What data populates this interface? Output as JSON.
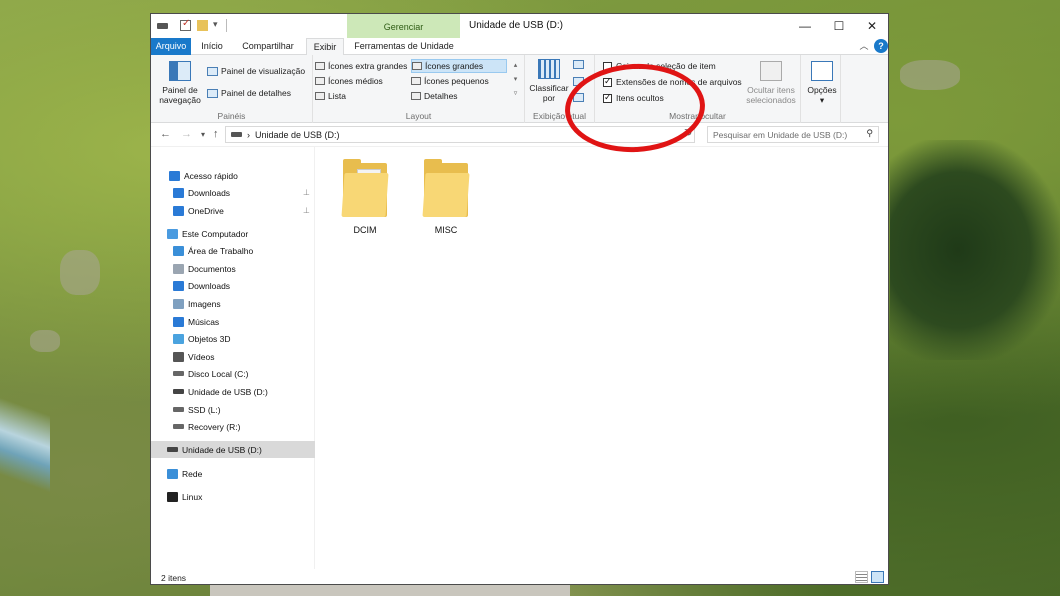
{
  "window": {
    "title": "Unidade de USB (D:)",
    "contextual_header": "Gerenciar",
    "controls": {
      "minimize": "—",
      "maximize": "☐",
      "close": "✕"
    }
  },
  "tabs": {
    "arquivo": "Arquivo",
    "inicio": "Início",
    "compartilhar": "Compartilhar",
    "exibir": "Exibir",
    "ferramentas": "Ferramentas de Unidade",
    "active": "Exibir"
  },
  "ribbon": {
    "paineis": {
      "label": "Painéis",
      "nav_pane_line1": "Painel de",
      "nav_pane_line2": "navegação",
      "preview": "Painel de visualização",
      "details": "Painel de detalhes"
    },
    "layout": {
      "label": "Layout",
      "items": [
        "Ícones extra grandes",
        "Ícones grandes",
        "Ícones médios",
        "Ícones pequenos",
        "Lista",
        "Detalhes"
      ],
      "selected": "Ícones grandes"
    },
    "exibicao_atual": {
      "label": "Exibição atual",
      "sort_line1": "Classificar",
      "sort_line2": "por"
    },
    "mostrar_ocultar": {
      "label": "Mostrar/ocultar",
      "item_checkboxes": {
        "label": "Caixas de seleção de item",
        "checked": false
      },
      "file_extensions": {
        "label": "Extensões de nomes de arquivos",
        "checked": true
      },
      "hidden_items": {
        "label": "Itens ocultos",
        "checked": true
      },
      "hide_selected_line1": "Ocultar itens",
      "hide_selected_line2": "selecionados"
    },
    "opcoes": "Opções"
  },
  "address": {
    "path": "Unidade de USB (D:)",
    "search_placeholder": "Pesquisar em Unidade de USB (D:)"
  },
  "nav_pane": {
    "items": [
      {
        "label": "Acesso rápido",
        "icon": "star-icon",
        "pinned": false
      },
      {
        "label": "Downloads",
        "icon": "download-icon",
        "pinned": true
      },
      {
        "label": "OneDrive",
        "icon": "cloud-icon",
        "pinned": true
      },
      {
        "label": "Este Computador",
        "icon": "computer-icon",
        "pinned": false
      },
      {
        "label": "Área de Trabalho",
        "icon": "desktop-icon",
        "pinned": false
      },
      {
        "label": "Documentos",
        "icon": "document-icon",
        "pinned": false
      },
      {
        "label": "Downloads",
        "icon": "download-icon",
        "pinned": false
      },
      {
        "label": "Imagens",
        "icon": "picture-icon",
        "pinned": false
      },
      {
        "label": "Músicas",
        "icon": "music-icon",
        "pinned": false
      },
      {
        "label": "Objetos 3D",
        "icon": "cube-icon",
        "pinned": false
      },
      {
        "label": "Vídeos",
        "icon": "video-icon",
        "pinned": false
      },
      {
        "label": "Disco Local (C:)",
        "icon": "drive-icon",
        "pinned": false
      },
      {
        "label": "Unidade de USB (D:)",
        "icon": "usb-drive-icon",
        "pinned": false
      },
      {
        "label": "SSD (L:)",
        "icon": "drive-icon",
        "pinned": false
      },
      {
        "label": "Recovery (R:)",
        "icon": "drive-icon",
        "pinned": false
      },
      {
        "label": "Unidade de USB (D:)",
        "icon": "usb-drive-icon",
        "pinned": false,
        "selected": true
      },
      {
        "label": "Rede",
        "icon": "network-icon",
        "pinned": false
      },
      {
        "label": "Linux",
        "icon": "penguin-icon",
        "pinned": false
      }
    ]
  },
  "files": [
    {
      "name": "DCIM",
      "icon": "folder-with-content-icon"
    },
    {
      "name": "MISC",
      "icon": "folder-icon"
    }
  ],
  "status": {
    "item_count": "2 itens"
  },
  "colors": {
    "accent": "#1979ca",
    "contextual_tab": "#cde8b8",
    "annotation": "#e01414",
    "folder": "#e8bd4e"
  }
}
